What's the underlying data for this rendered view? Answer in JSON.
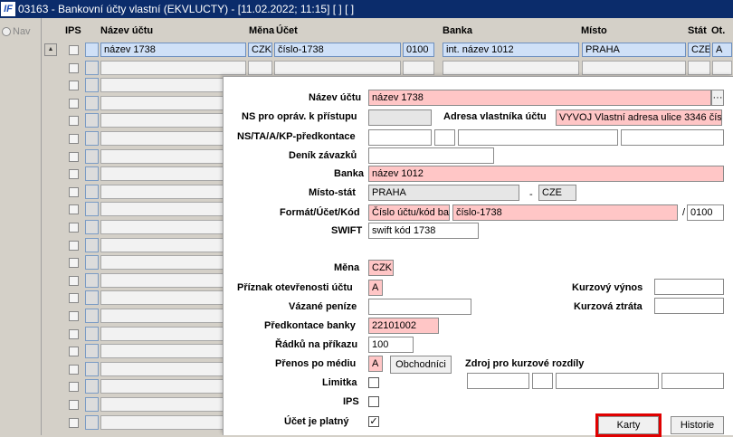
{
  "window": {
    "logo": "IF",
    "title": "03163 - Bankovní účty vlastní (EKVLUCTY) - [11.02.2022; 11:15]  [ ]  [ ]"
  },
  "nav": {
    "label": "Nav"
  },
  "columns": {
    "ips": "IPS",
    "nazev": "Název účtu",
    "mena": "Měna",
    "ucet": "Účet",
    "banka": "Banka",
    "misto": "Místo",
    "stat": "Stát",
    "ot": "Ot."
  },
  "rows": [
    {
      "nazev": "název 1738",
      "mena": "CZK",
      "ucet": "číslo-1738",
      "kod": "0100",
      "banka": "int. název 1012",
      "misto": "PRAHA",
      "stat": "CZE",
      "ot": "A"
    }
  ],
  "detail": {
    "nazev_uctu_label": "Název účtu",
    "nazev_uctu": "název 1738",
    "dots": "···",
    "ns_opravneni_label": "NS pro opráv. k přístupu",
    "adresa_label": "Adresa vlastníka účtu",
    "adresa": "VYVOJ Vlastní adresa ulice 3346 čís",
    "predkontace_label": "NS/TA/A/KP-předkontace",
    "denik_label": "Deník závazků",
    "banka_label": "Banka",
    "banka": "název 1012",
    "misto_stat_label": "Místo-stát",
    "misto": "PRAHA",
    "dash": "-",
    "stat": "CZE",
    "format_label": "Formát/Účet/Kód",
    "format": "Číslo účtu/kód bar",
    "cislo": "číslo-1738",
    "slash": "/",
    "kod": "0100",
    "swift_label": "SWIFT",
    "swift": "swift kód 1738",
    "mena_label": "Měna",
    "mena": "CZK",
    "priznak_label": "Příznak otevřenosti účtu",
    "priznak": "A",
    "vazane_label": "Vázané peníze",
    "predkontace_banky_label": "Předkontace banky",
    "predkontace_banky": "22101002",
    "radku_label": "Řádků na příkazu",
    "radku": "100",
    "prenos_label": "Přenos po médiu",
    "prenos": "A",
    "obchodni_label": "Obchodníci",
    "limitka_label": "Limitka",
    "ips_label": "IPS",
    "platny_label": "Účet je platný",
    "platny_check": "✓",
    "kurzovy_vynos_label": "Kurzový výnos",
    "kurzova_ztrata_label": "Kurzová ztráta",
    "zdroj_label": "Zdroj pro kurzové rozdíly",
    "karty_label": "Karty",
    "historie_label": "Historie"
  },
  "colors": {
    "titlebar": "#0b2c6b",
    "required_field": "#ffc6c6",
    "selected_row": "#cfe0f7",
    "highlight_border": "#e00000"
  }
}
